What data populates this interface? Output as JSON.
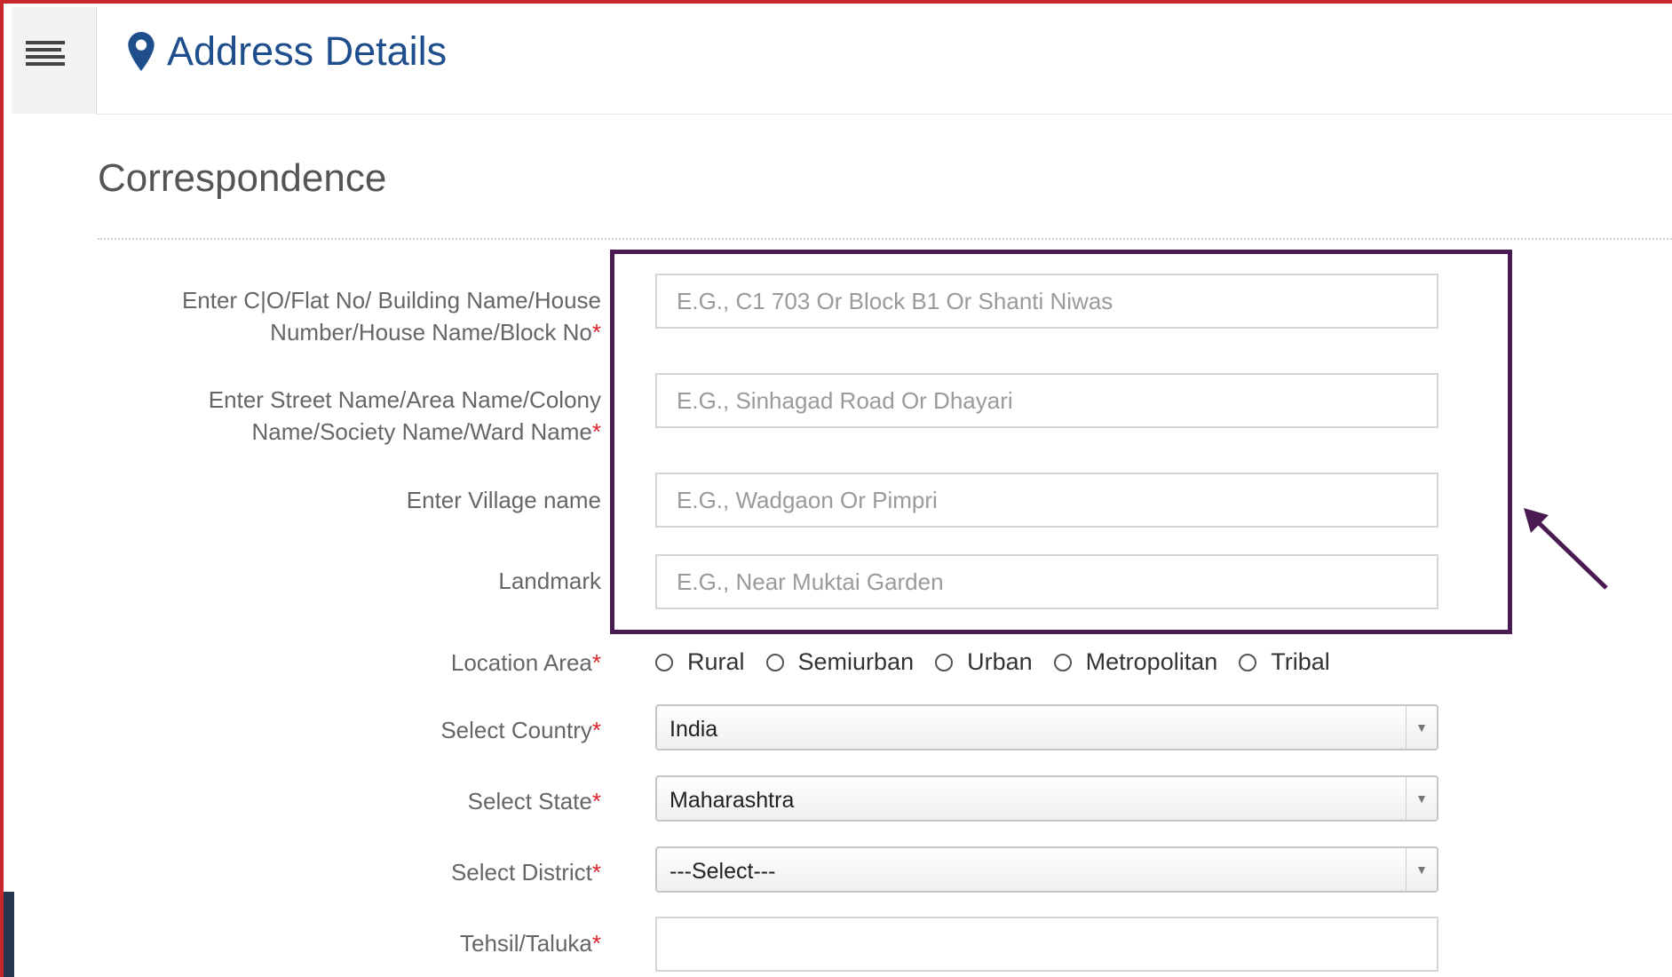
{
  "header": {
    "title": "Address Details"
  },
  "section": {
    "title": "Correspondence"
  },
  "form": {
    "flat_label_line1": "Enter C|O/Flat No/ Building Name/House",
    "flat_label_line2": "Number/House Name/Block No",
    "flat_placeholder": "E.G., C1 703 Or Block B1 Or Shanti Niwas",
    "street_label_line1": "Enter Street Name/Area Name/Colony",
    "street_label_line2": "Name/Society Name/Ward Name",
    "street_placeholder": "E.G., Sinhagad Road Or Dhayari",
    "village_label": "Enter Village name",
    "village_placeholder": "E.G., Wadgaon Or Pimpri",
    "landmark_label": "Landmark",
    "landmark_placeholder": "E.G., Near Muktai Garden",
    "location_label": "Location Area",
    "location_options": [
      "Rural",
      "Semiurban",
      "Urban",
      "Metropolitan",
      "Tribal"
    ],
    "country_label": "Select Country",
    "country_value": "India",
    "state_label": "Select State",
    "state_value": "Maharashtra",
    "district_label": "Select District",
    "district_value": "---Select---",
    "tehsil_label": "Tehsil/Taluka",
    "required_mark": "*"
  },
  "icons": {
    "menu": "hamburger-menu-icon",
    "location": "map-pin-icon",
    "dropdown": "caret-down-icon"
  },
  "colors": {
    "title_blue": "#1f4e8c",
    "highlight_border": "#4a1a52",
    "required": "#d9262a",
    "frame_border": "#c8282b"
  }
}
